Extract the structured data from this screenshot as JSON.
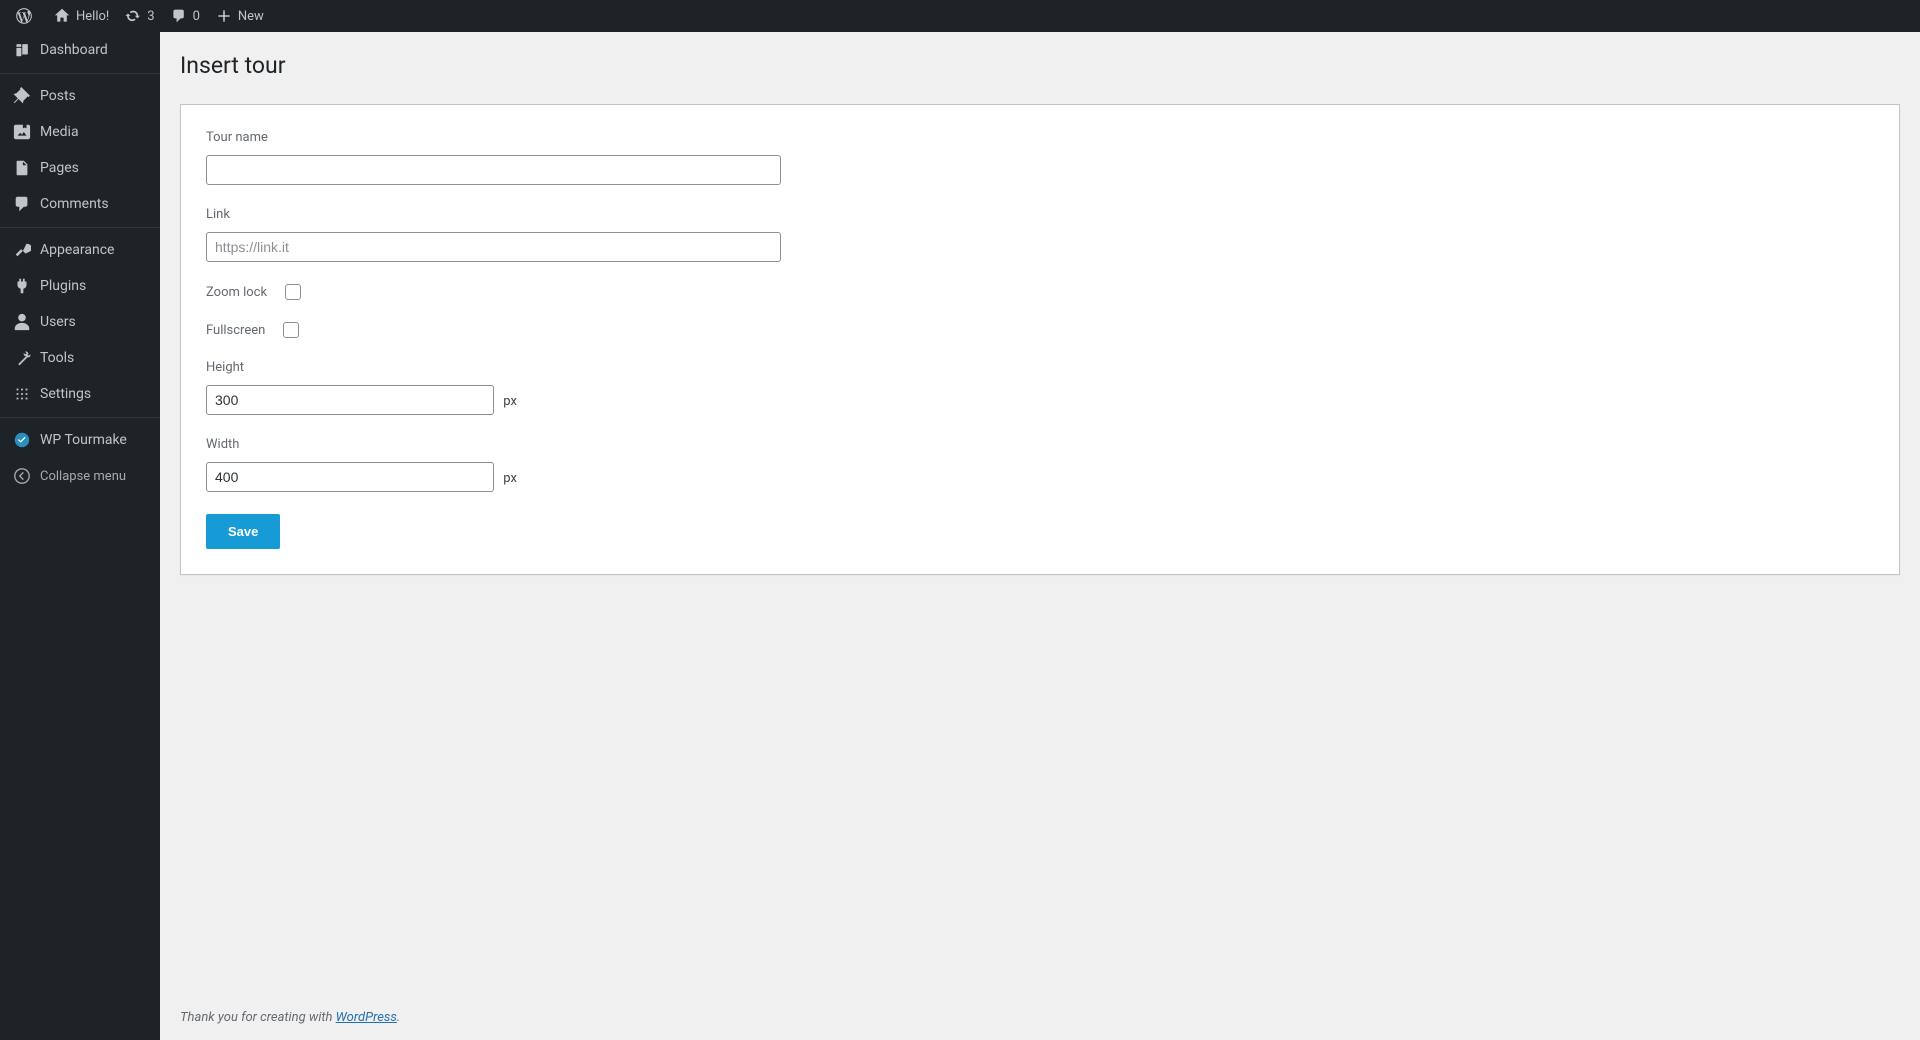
{
  "adminbar": {
    "site_name": "Hello!",
    "updates_count": "3",
    "comments_count": "0",
    "new_label": "New"
  },
  "sidebar": {
    "items": [
      {
        "label": "Dashboard"
      },
      {
        "label": "Posts"
      },
      {
        "label": "Media"
      },
      {
        "label": "Pages"
      },
      {
        "label": "Comments"
      },
      {
        "label": "Appearance"
      },
      {
        "label": "Plugins"
      },
      {
        "label": "Users"
      },
      {
        "label": "Tools"
      },
      {
        "label": "Settings"
      },
      {
        "label": "WP Tourmake"
      }
    ],
    "collapse_label": "Collapse menu"
  },
  "page": {
    "title": "Insert tour"
  },
  "form": {
    "tour_name_label": "Tour name",
    "tour_name_value": "",
    "link_label": "Link",
    "link_placeholder": "https://link.it",
    "link_value": "",
    "zoom_lock_label": "Zoom lock",
    "fullscreen_label": "Fullscreen",
    "height_label": "Height",
    "height_value": "300",
    "height_unit": "px",
    "width_label": "Width",
    "width_value": "400",
    "width_unit": "px",
    "save_label": "Save"
  },
  "footer": {
    "thanks_prefix": "Thank you for creating with ",
    "wp_link": "WordPress",
    "thanks_suffix": "."
  }
}
